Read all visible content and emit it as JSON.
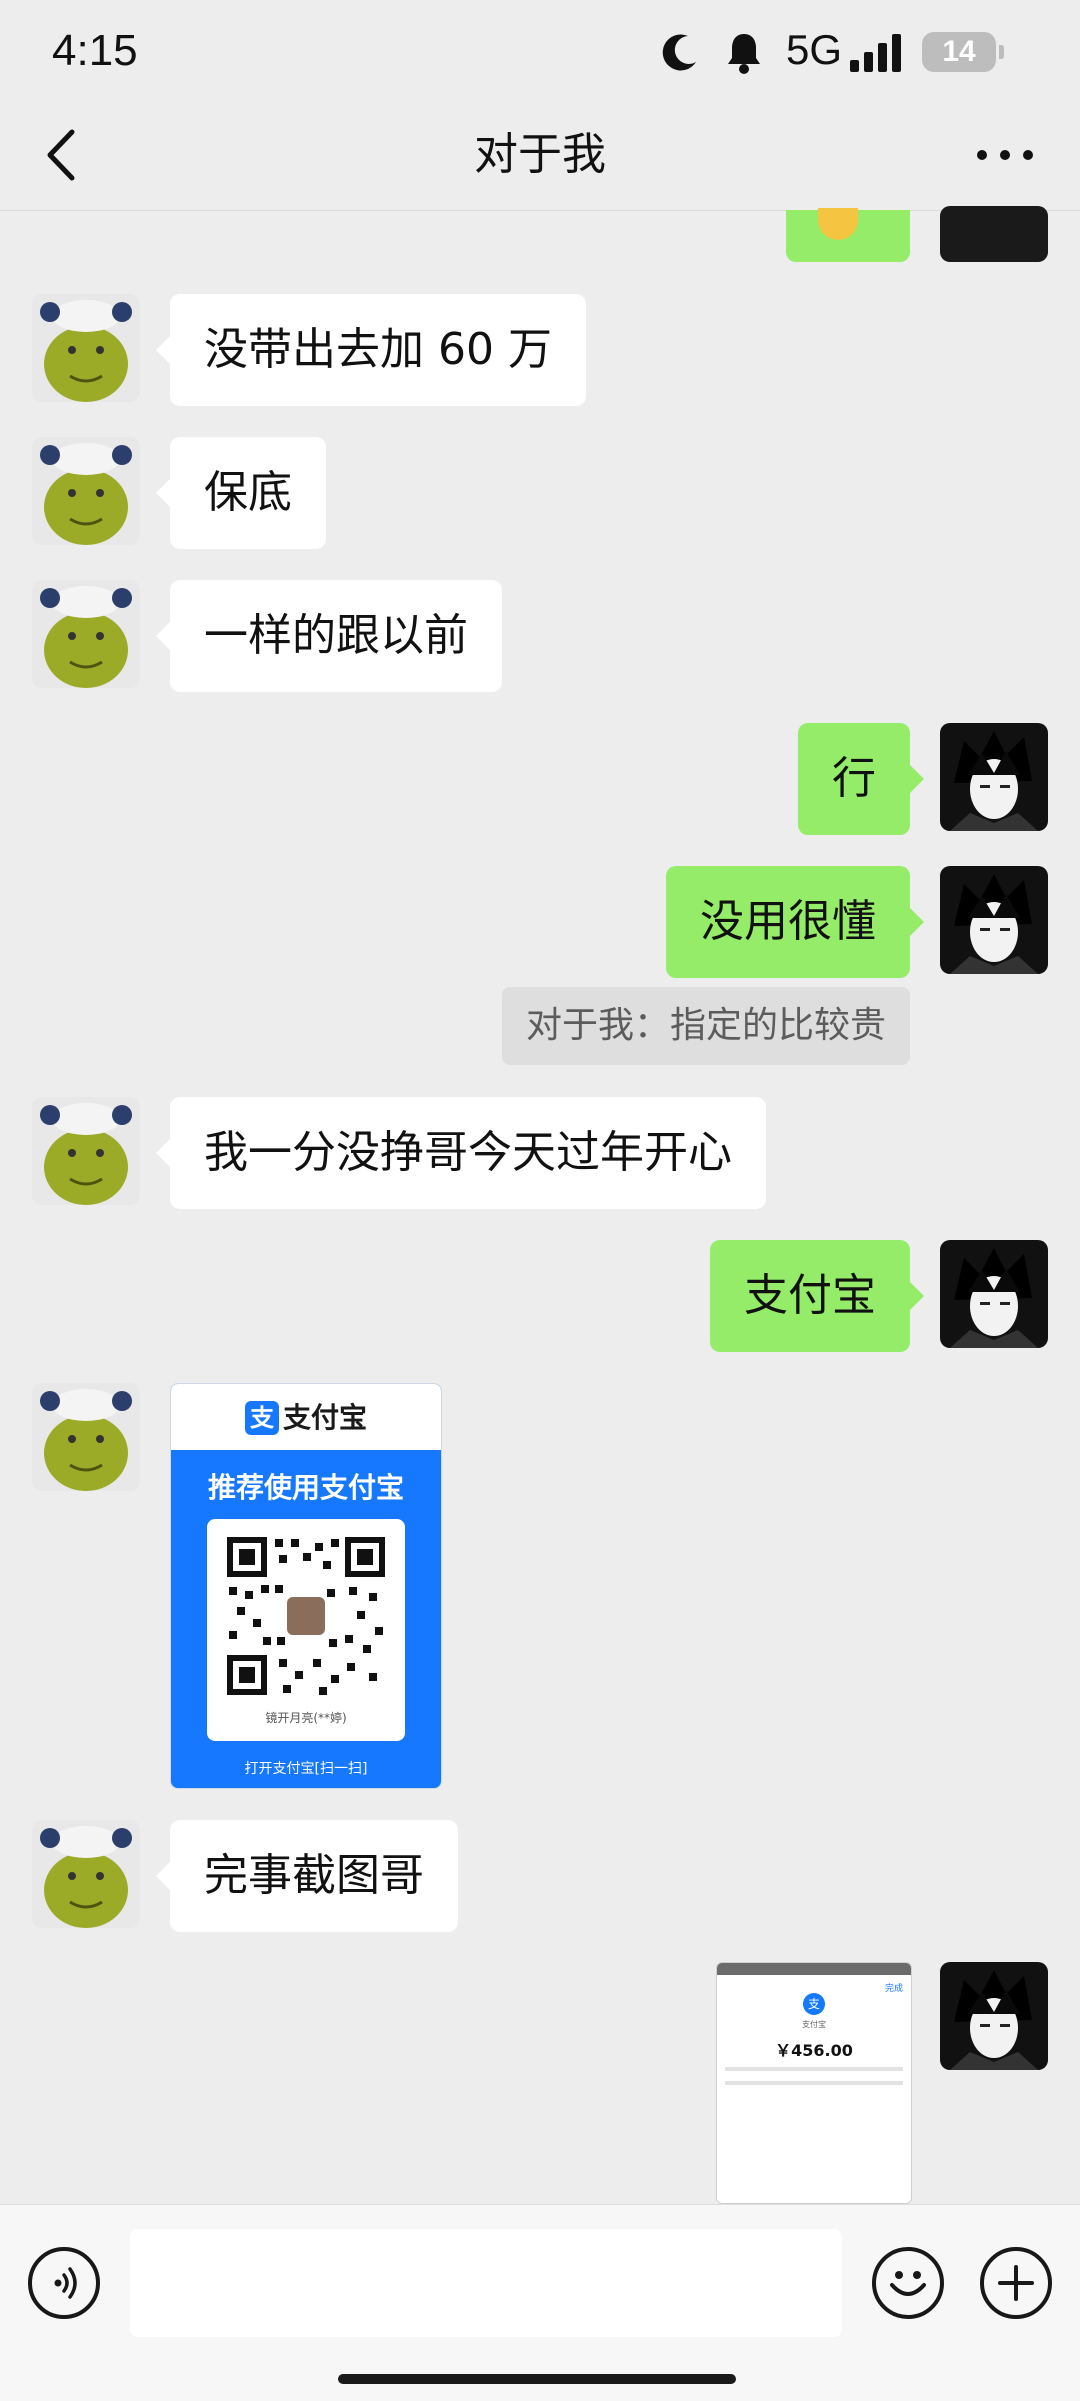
{
  "status_bar": {
    "time": "4:15",
    "network": "5G",
    "battery": "14"
  },
  "header": {
    "title": "对于我"
  },
  "messages": [
    {
      "side": "left",
      "text": "没带出去加 60 万"
    },
    {
      "side": "left",
      "text": "保底"
    },
    {
      "side": "left",
      "text": "一样的跟以前"
    },
    {
      "side": "right",
      "text": "行"
    },
    {
      "side": "right",
      "text": "没用很懂"
    },
    {
      "side": "quote",
      "text": "对于我：指定的比较贵"
    },
    {
      "side": "left",
      "text": "我一分没挣哥今天过年开心"
    },
    {
      "side": "right",
      "text": "支付宝"
    },
    {
      "side": "left",
      "type": "image",
      "alt": "alipay-qr"
    },
    {
      "side": "left",
      "text": "完事截图哥"
    },
    {
      "side": "right",
      "type": "image",
      "alt": "payment-screenshot"
    }
  ],
  "qr_card": {
    "brand": "支付宝",
    "title": "推荐使用支付宝",
    "name": "镜开月亮(**婷)",
    "open_text": "打开支付宝[扫一扫]"
  },
  "payment_shot": {
    "amount": "￥456.00",
    "done": "完成",
    "brand": "支付宝"
  },
  "colors": {
    "bubble_self": "#95ec69",
    "bubble_other": "#ffffff",
    "background": "#ededed",
    "alipay_blue": "#1677ff"
  }
}
